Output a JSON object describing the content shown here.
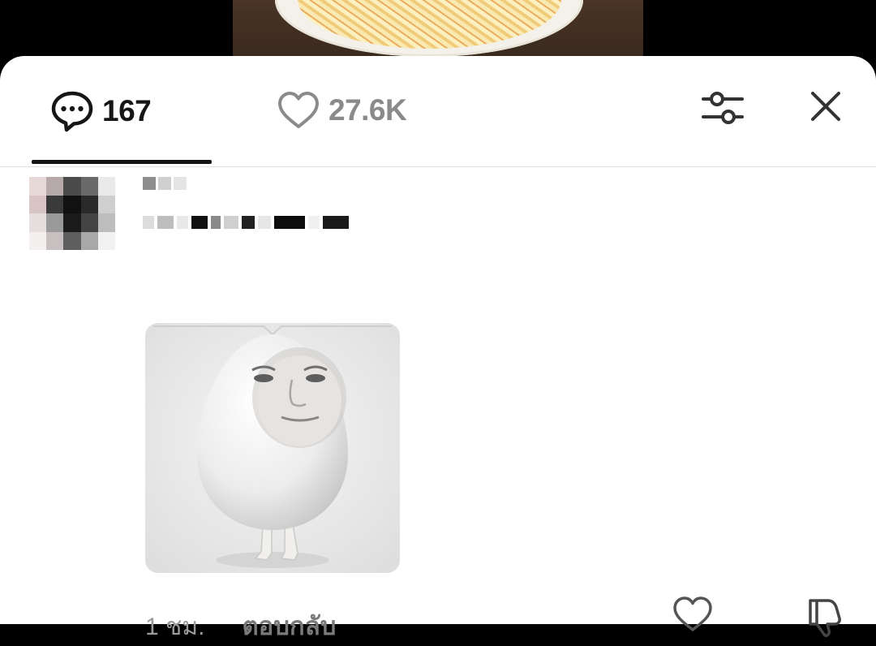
{
  "header": {
    "comments_count": "167",
    "likes_count": "27.6K"
  },
  "comment": {
    "timestamp": "1 ชม.",
    "reply_label": "ตอบกลับ"
  },
  "icons": {
    "comments_tab": "speech-bubble-icon",
    "likes_tab": "heart-outline-icon",
    "filter": "sliders-icon",
    "close": "close-icon",
    "like": "heart-outline-icon",
    "dislike": "thumbs-down-icon"
  },
  "colors": {
    "active_tab": "#161616",
    "inactive_tab": "#8a8a8a",
    "muted_text": "#9a9a9a"
  }
}
